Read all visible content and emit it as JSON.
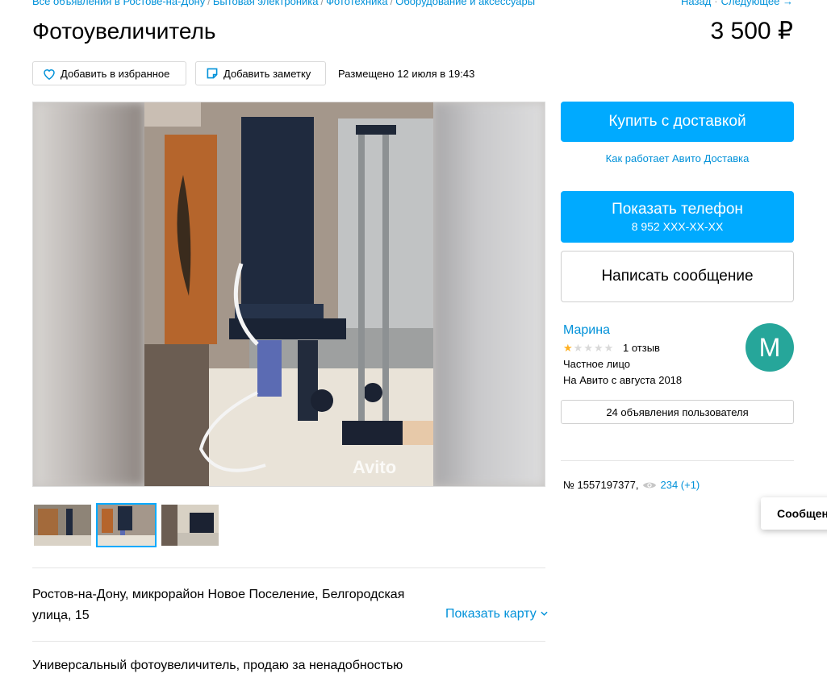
{
  "breadcrumbs": [
    "Все объявления в Ростове-на-Дону",
    "Бытовая электроника",
    "Фототехника",
    "Оборудование и аксессуары"
  ],
  "nav": {
    "back": "Назад",
    "next": "Следующее →"
  },
  "title": "Фотоувеличитель",
  "price": "3 500 ₽",
  "toolbar": {
    "favorite": "Добавить в избранное",
    "note": "Добавить заметку",
    "posted": "Размещено 12 июля в 19:43"
  },
  "gallery": {
    "watermark": "Avito",
    "thumb_count": 3,
    "active_thumb": 2
  },
  "location": {
    "address_line1": "Ростов-на-Дону, микрорайон Новое Поселение, Белгородская",
    "address_line2": "улица, 15",
    "show_map": "Показать карту"
  },
  "description": "Универсальный фотоувеличитель, продаю за ненадобностью",
  "actions": {
    "buy": "Купить с доставкой",
    "how_delivery": "Как работает Авито Доставка",
    "show_phone": "Показать телефон",
    "phone_masked": "8 952 XXX-XX-XX",
    "write_message": "Написать сообщение"
  },
  "seller": {
    "name": "Марина",
    "avatar_letter": "M",
    "rating": 1,
    "rating_max": 5,
    "reviews": "1 отзыв",
    "type": "Частное лицо",
    "since": "На Авито с августа 2018",
    "ads_count_label": "24 объявления пользователя"
  },
  "ad": {
    "number": "№ 1557197377,",
    "views": "234 (+1)"
  },
  "floating": {
    "messages": "Сообщения"
  },
  "colors": {
    "accent": "#00aaff",
    "link": "#0091d9",
    "avatar": "#26a69a",
    "star": "#ffb021"
  }
}
